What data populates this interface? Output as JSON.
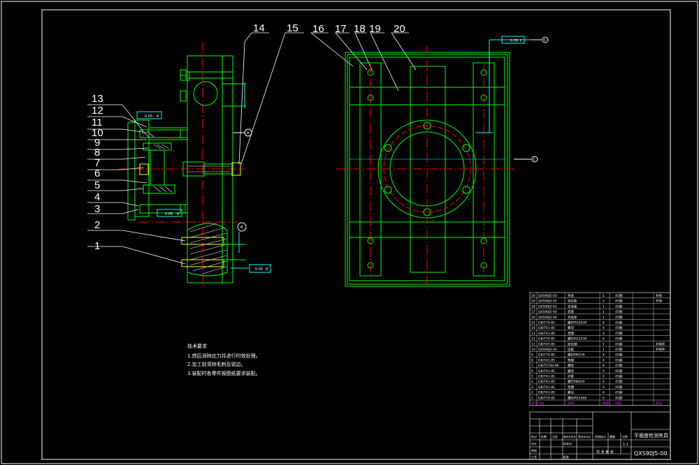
{
  "balloons": [
    "1",
    "2",
    "3",
    "4",
    "5",
    "6",
    "7",
    "8",
    "9",
    "10",
    "11",
    "12",
    "13",
    "14",
    "15",
    "16",
    "17",
    "18",
    "19",
    "20"
  ],
  "datum_labels": {
    "A": "A",
    "B": "B",
    "C": "C"
  },
  "tolerance_frames": [
    "0.05",
    "A",
    "0.05",
    "A",
    "0.05",
    "C",
    "0.05",
    "B"
  ],
  "tech_notes": {
    "title": "技术要求",
    "items": [
      "1.焊后消除应力并进行时效处理。",
      "2.加工前清除毛刺及锐边。",
      "3.装配时各零件按图纸要求装配。"
    ]
  },
  "bom": {
    "rows": [
      {
        "no": "20",
        "code": "QXS90J5-03",
        "name": "夹具",
        "qty": "1",
        "mat": "45钢",
        "note": "外购"
      },
      {
        "no": "19",
        "code": "QXS90J5-02",
        "name": "定位板",
        "qty": "2",
        "mat": "45钢",
        "note": "外购"
      },
      {
        "no": "18",
        "code": "QXS90J5-01",
        "name": "支承板",
        "qty": "1",
        "mat": "45钢",
        "note": ""
      },
      {
        "no": "17",
        "code": "QXS90J5-00",
        "name": "底座",
        "qty": "1",
        "mat": "45钢",
        "note": ""
      },
      {
        "no": "16",
        "code": "QXS90J5-00",
        "name": "夹具体",
        "qty": "1",
        "mat": "45钢",
        "note": ""
      },
      {
        "no": "15",
        "code": "GB/T70-85",
        "name": "螺钉M10X30",
        "qty": "6",
        "mat": "45钢",
        "note": ""
      },
      {
        "no": "14",
        "code": "GB/T41-85",
        "name": "螺母",
        "qty": "4",
        "mat": "45钢",
        "note": ""
      },
      {
        "no": "13",
        "code": "GB/T41-85",
        "name": "垫圈",
        "qty": "4",
        "mat": "45钢",
        "note": ""
      },
      {
        "no": "12",
        "code": "GB/T70-85",
        "name": "螺钉M12X34",
        "qty": "6",
        "mat": "45钢",
        "note": ""
      },
      {
        "no": "11",
        "code": "GB/T97-85",
        "name": "定位销",
        "qty": "1",
        "mat": "45钢",
        "note": "外购件"
      },
      {
        "no": "10",
        "code": "QXS90J5-04",
        "name": "压板",
        "qty": "1",
        "mat": "45钢",
        "note": "外购件"
      },
      {
        "no": "9",
        "code": "GB/T70-85",
        "name": "螺钉M6X16",
        "qty": "4",
        "mat": "45钢",
        "note": ""
      },
      {
        "no": "8",
        "code": "GB/T41-85",
        "name": "垫圈",
        "qty": "4",
        "mat": "45钢",
        "note": ""
      },
      {
        "no": "7",
        "code": "GB/T5783-86",
        "name": "螺栓",
        "qty": "4",
        "mat": "45钢",
        "note": ""
      },
      {
        "no": "6",
        "code": "GB/T41-85",
        "name": "螺母",
        "qty": "4",
        "mat": "45钢",
        "note": ""
      },
      {
        "no": "5",
        "code": "GB/T41-85",
        "name": "衬套",
        "qty": "2",
        "mat": "45钢",
        "note": ""
      },
      {
        "no": "4",
        "code": "GB/T41-85",
        "name": "螺钉M8X20",
        "qty": "4",
        "mat": "45钢",
        "note": ""
      },
      {
        "no": "3",
        "code": "GB/T41-85",
        "name": "垫圈",
        "qty": "4",
        "mat": "45钢",
        "note": ""
      },
      {
        "no": "2",
        "code": "GB/T41-85",
        "name": "螺母",
        "qty": "6",
        "mat": "45钢",
        "note": ""
      },
      {
        "no": "1",
        "code": "GB/T70-85",
        "name": "螺钉M12X60",
        "qty": "6",
        "mat": "45钢",
        "note": ""
      }
    ],
    "header": [
      "序号",
      "代号",
      "名称",
      "数量",
      "材料",
      "备注"
    ]
  },
  "title_block": {
    "drawing_name": "平面度检测夹具",
    "drawing_number": "QXS90J5-00",
    "scale": "1:1",
    "sheet_label": "共 张 第 张",
    "cells": [
      "标记",
      "处数",
      "分区",
      "更改文件号",
      "签名",
      "年月日",
      "设计",
      "标准化",
      "审核",
      "工艺",
      "批准",
      "阶段标记",
      "重量",
      "比例"
    ]
  },
  "colors": {
    "green": "#00ff00",
    "red": "#ff0000",
    "white": "#ffffff",
    "cyan": "#00ffff",
    "yellow": "#ffff00",
    "magenta": "#ff00ff",
    "bg": "#000000"
  }
}
